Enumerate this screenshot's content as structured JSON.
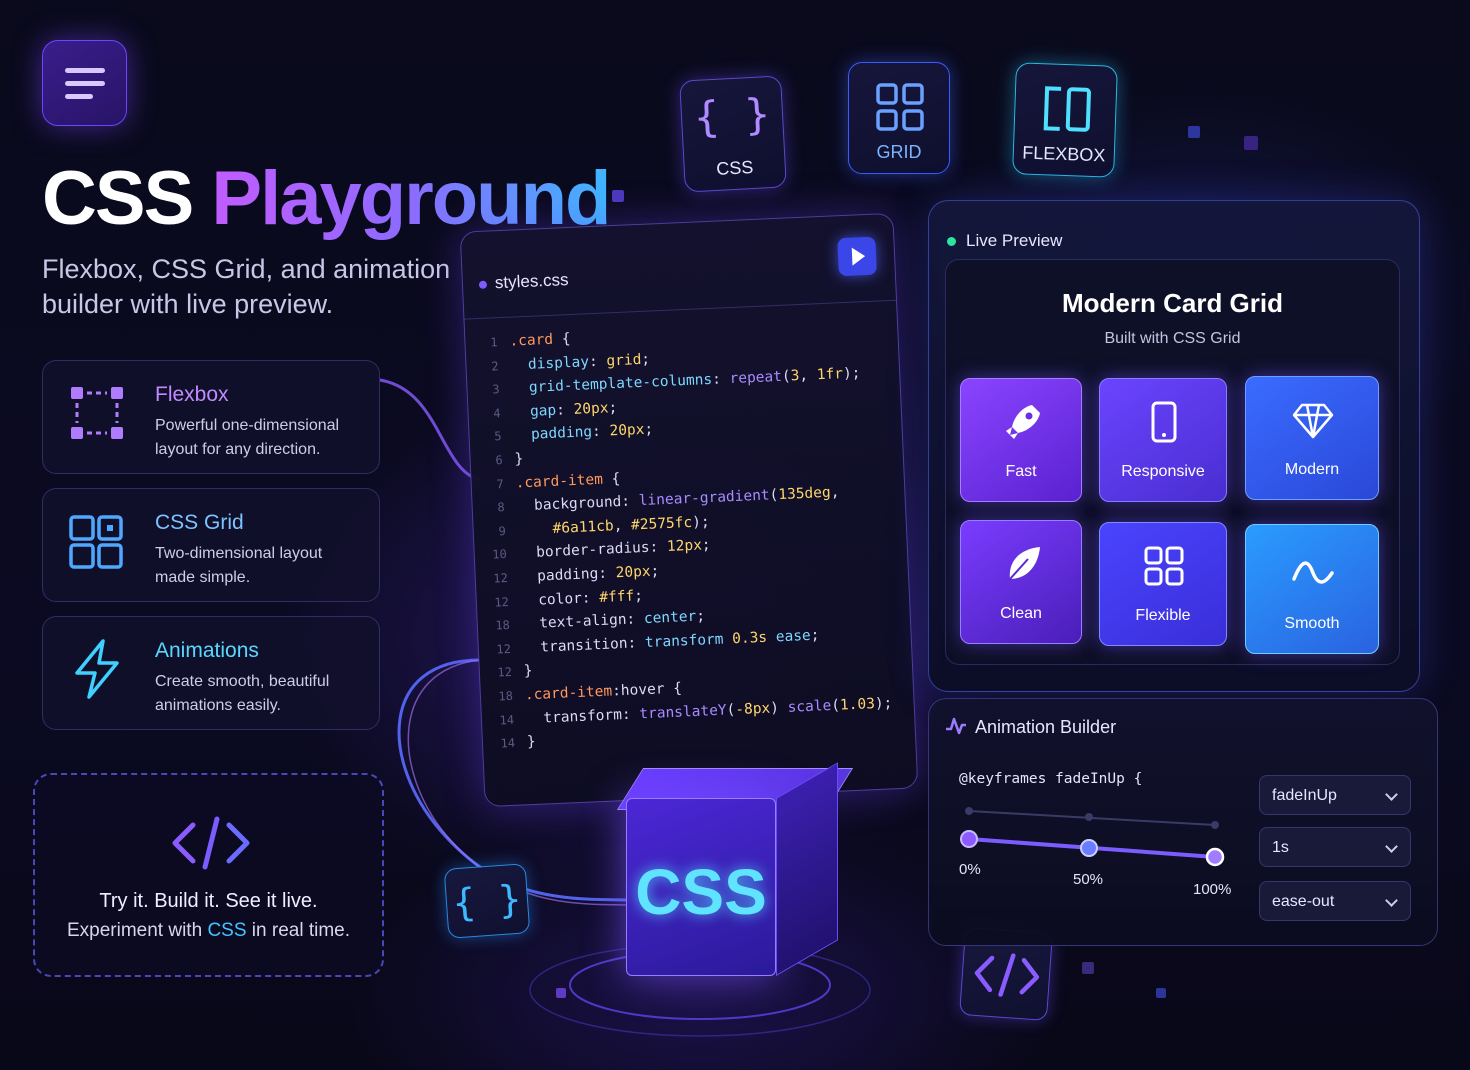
{
  "header": {
    "title_part1": "CSS",
    "title_part2": "Playground",
    "subtitle": "Flexbox, CSS Grid, and animation builder with live preview."
  },
  "features": [
    {
      "title": "Flexbox",
      "description": "Powerful one-dimensional layout for any direction.",
      "icon": "flexbox-dashed-icon",
      "title_color": "#c08bff"
    },
    {
      "title": "CSS Grid",
      "description": "Two-dimensional layout made simple.",
      "icon": "grid-layout-icon",
      "title_color": "#7cc3ff"
    },
    {
      "title": "Animations",
      "description": "Create smooth, beautiful animations easily.",
      "icon": "lightning-icon",
      "title_color": "#5ad7ff"
    }
  ],
  "try_box": {
    "line1": "Try it. Build it. See it live.",
    "line2_before": "Experiment with",
    "line2_highlight": "CSS",
    "line2_after": "in real time.",
    "icon": "code-tag-icon"
  },
  "top_chips": [
    {
      "label": "CSS",
      "icon": "braces-icon"
    },
    {
      "label": "GRID",
      "icon": "grid-icon"
    },
    {
      "label": "FLEXBOX",
      "icon": "flexbox-icon"
    }
  ],
  "editor": {
    "filename": "styles.css",
    "run_icon": "play-icon",
    "lines": [
      {
        "n": "1",
        "parts": [
          [
            "sel",
            ".card"
          ],
          [
            "p",
            " {"
          ]
        ]
      },
      {
        "n": "2",
        "parts": [
          [
            "p",
            "  "
          ],
          [
            "prop",
            "display"
          ],
          [
            "p",
            ": "
          ],
          [
            "val",
            "grid"
          ],
          [
            "p",
            ";"
          ]
        ]
      },
      {
        "n": "3",
        "parts": [
          [
            "p",
            "  "
          ],
          [
            "prop",
            "grid-template-columns"
          ],
          [
            "p",
            ": "
          ],
          [
            "fn",
            "repeat"
          ],
          [
            "p",
            "("
          ],
          [
            "val",
            "3"
          ],
          [
            "p",
            ", "
          ],
          [
            "val",
            "1fr"
          ],
          [
            "p",
            ");"
          ]
        ]
      },
      {
        "n": "4",
        "parts": [
          [
            "p",
            "  "
          ],
          [
            "prop",
            "gap"
          ],
          [
            "p",
            ": "
          ],
          [
            "val",
            "20px"
          ],
          [
            "p",
            ";"
          ]
        ]
      },
      {
        "n": "5",
        "parts": [
          [
            "p",
            "  "
          ],
          [
            "prop",
            "padding"
          ],
          [
            "p",
            ": "
          ],
          [
            "val",
            "20px"
          ],
          [
            "p",
            ";"
          ]
        ]
      },
      {
        "n": "6",
        "parts": [
          [
            "p",
            "}"
          ]
        ]
      },
      {
        "n": "7",
        "parts": [
          [
            "sel",
            ".card-item"
          ],
          [
            "p",
            " {"
          ]
        ]
      },
      {
        "n": "8",
        "parts": [
          [
            "p",
            "  background: "
          ],
          [
            "fn",
            "linear-gradient"
          ],
          [
            "p",
            "("
          ],
          [
            "val",
            "135deg"
          ],
          [
            "p",
            ","
          ]
        ]
      },
      {
        "n": "9",
        "parts": [
          [
            "p",
            "    "
          ],
          [
            "val",
            "#6a11cb"
          ],
          [
            "p",
            ", "
          ],
          [
            "val",
            "#2575fc"
          ],
          [
            "p",
            ");"
          ]
        ]
      },
      {
        "n": "10",
        "parts": [
          [
            "p",
            "  border-radius: "
          ],
          [
            "val",
            "12px"
          ],
          [
            "p",
            ";"
          ]
        ]
      },
      {
        "n": "12",
        "parts": [
          [
            "p",
            "  padding: "
          ],
          [
            "val",
            "20px"
          ],
          [
            "p",
            ";"
          ]
        ]
      },
      {
        "n": "12",
        "parts": [
          [
            "p",
            "  color: "
          ],
          [
            "val",
            "#fff"
          ],
          [
            "p",
            ";"
          ]
        ]
      },
      {
        "n": "18",
        "parts": [
          [
            "p",
            "  text-align: "
          ],
          [
            "prop",
            "center"
          ],
          [
            "p",
            ";"
          ]
        ]
      },
      {
        "n": "12",
        "parts": [
          [
            "p",
            "  transition: "
          ],
          [
            "prop",
            "transform"
          ],
          [
            "p",
            " "
          ],
          [
            "val",
            "0.3s"
          ],
          [
            "p",
            " "
          ],
          [
            "prop",
            "ease"
          ],
          [
            "p",
            ";"
          ]
        ]
      },
      {
        "n": "12",
        "parts": [
          [
            "p",
            "}"
          ]
        ]
      },
      {
        "n": "18",
        "parts": [
          [
            "sel",
            ".card-item"
          ],
          [
            "p",
            ":hover {"
          ]
        ]
      },
      {
        "n": "14",
        "parts": [
          [
            "p",
            "  transform: "
          ],
          [
            "fn",
            "translateY"
          ],
          [
            "p",
            "("
          ],
          [
            "val",
            "-8px"
          ],
          [
            "p",
            ") "
          ],
          [
            "fn",
            "scale"
          ],
          [
            "p",
            "("
          ],
          [
            "val",
            "1.03"
          ],
          [
            "p",
            ");"
          ]
        ]
      },
      {
        "n": "14",
        "parts": [
          [
            "p",
            "}"
          ]
        ]
      }
    ]
  },
  "preview": {
    "header": "Live Preview",
    "title": "Modern Card Grid",
    "subtitle": "Built with CSS Grid",
    "cards": [
      {
        "label": "Fast",
        "icon": "rocket-icon"
      },
      {
        "label": "Responsive",
        "icon": "phone-icon"
      },
      {
        "label": "Modern",
        "icon": "diamond-icon"
      },
      {
        "label": "Clean",
        "icon": "leaf-icon"
      },
      {
        "label": "Flexible",
        "icon": "grid-icon"
      },
      {
        "label": "Smooth",
        "icon": "wave-icon"
      }
    ]
  },
  "animation_builder": {
    "title": "Animation Builder",
    "icon": "activity-icon",
    "keyframes_text": "@keyframes fadeInUp {",
    "stops": [
      "0%",
      "50%",
      "100%"
    ],
    "name_value": "fadeInUp",
    "duration_value": "1s",
    "easing_value": "ease-out"
  },
  "cube_label": "CSS",
  "colors": {
    "accent_purple": "#7d5cff",
    "accent_blue": "#3fb6ff",
    "live_dot": "#2de3a0"
  }
}
